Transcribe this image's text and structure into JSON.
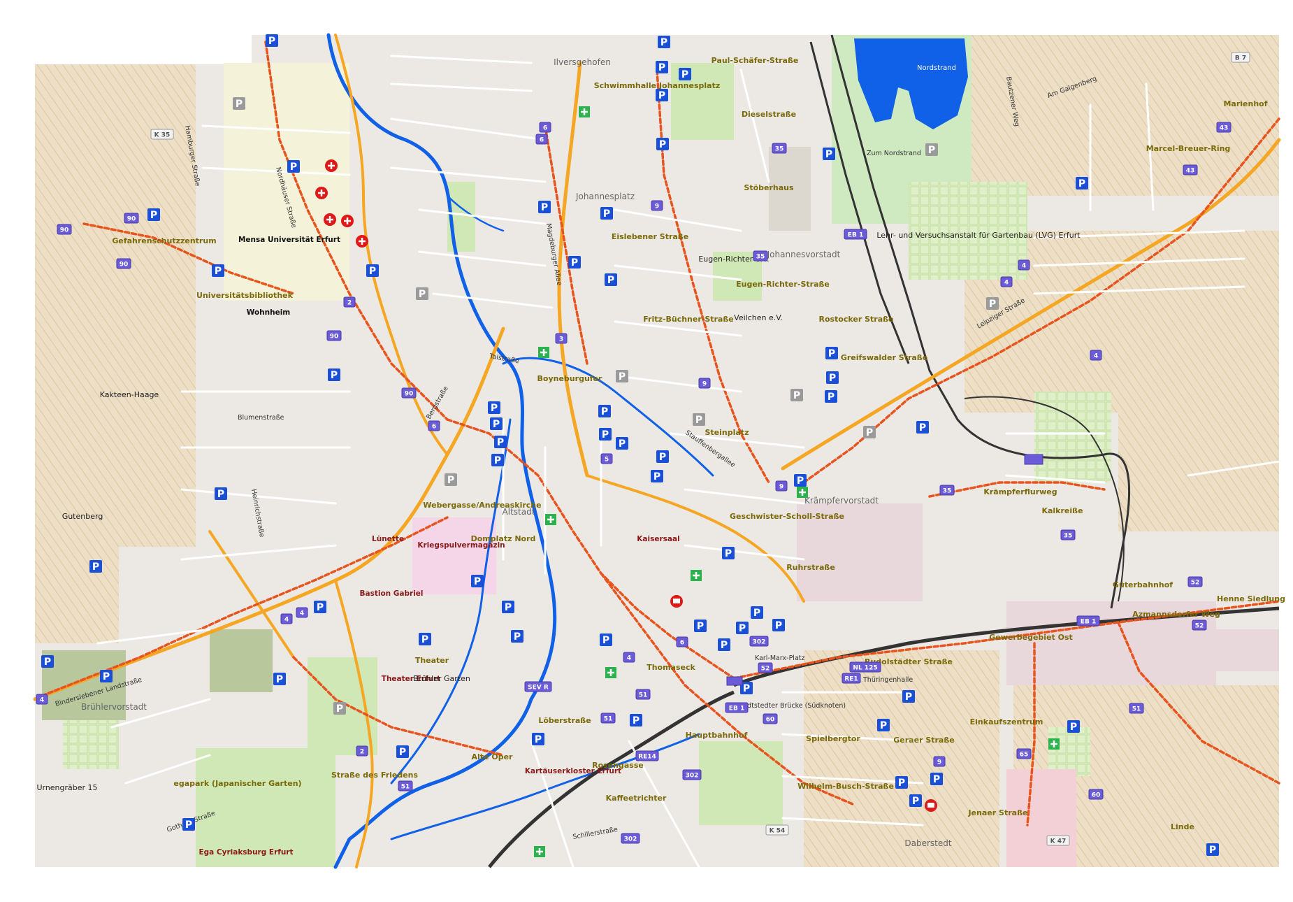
{
  "map": {
    "labels": {
      "districts": [
        "Ilversgehofen",
        "Johannesplatz",
        "Johannesvorstadt",
        "Krämpfervorstadt",
        "Altstadt",
        "Brühlervorstadt",
        "Daberstedt"
      ],
      "stops": [
        "Paul-Schäfer-Straße",
        "Schwimmhalle Johannesplatz",
        "Dieselstraße",
        "Marcel-Breuer-Ring",
        "Stöberhaus",
        "Eislebener Straße",
        "Eugen-Richter-Straße",
        "Rostocker Straße",
        "Fritz-Büchner-Straße",
        "Greifswalder Straße",
        "Boyneburgufer",
        "Steinplatz",
        "Universitätsbibliothek",
        "Gefahrenschutzzentrum",
        "Webergasse/Andreaskirche",
        "Krämpferflurweg",
        "Kalkreiße",
        "Geschwister-Scholl-Straße",
        "Ruhrstraße",
        "Domplatz Nord",
        "Theater",
        "Thomaseck",
        "Hauptbahnhof",
        "Rudolstädter Straße",
        "Gewerbegebiet Ost",
        "Azmannsdorfer Weg",
        "Henne Siedlung",
        "Güterbahnhof",
        "Einkaufszentrum",
        "Spielbergtor",
        "Geraer Straße",
        "Wilhelm-Busch-Straße",
        "Jenaer Straße",
        "Linde",
        "Löberstraße",
        "Alte Oper",
        "Straße des Friedens",
        "Rosengasse",
        "Kaffeetrichter",
        "Marienhof"
      ],
      "places": [
        "Mensa Universität Erfurt",
        "Wohnheim",
        "Kakteen-Haage",
        "Gutenberg",
        "Lünette",
        "Kriegspulvermagazin",
        "Bastion Gabriel",
        "Theater Erfurt",
        "Brühler Garten",
        "Kaisersaal",
        "Kartäuserkloster Erfurt",
        "egapark (Japanischer Garten)",
        "Ega Cyriaksburg Erfurt",
        "Urnengräber 15",
        "Nordstrand",
        "Lehr- und Versuchsanstalt für Gartenbau (LVG) Erfurt",
        "Eugen-Richter e.V.",
        "Veilchen e.V."
      ],
      "streets": [
        "Leipziger Straße",
        "Stauffenbergallee",
        "Talstraße",
        "Bergstraße",
        "Nordhäuser Straße",
        "Magdeburger Allee",
        "Binderslebener Landstraße",
        "Gothaer Straße",
        "Schillerstraße",
        "Blumenstraße",
        "Heinrichstraße",
        "Hamburger Straße",
        "Schmidtstedter Brücke (Südknoten)",
        "Zum Nordstrand",
        "Am Galgenberg",
        "Bautzener Weg",
        "Thüringenhalle",
        "Karl-Marx-Platz"
      ]
    },
    "road_shields": [
      "K 35",
      "B 7",
      "K 54",
      "K 47",
      "90",
      "2",
      "4",
      "3",
      "5",
      "6",
      "9",
      "35",
      "43",
      "51",
      "52",
      "60",
      "65",
      "302",
      "EB 1",
      "RE14",
      "NL 125",
      "RE1",
      "SEV R"
    ],
    "colors": {
      "water": "#1060e8",
      "primary_road": "#f5a623",
      "tram_route": "#e8541e",
      "rail": "#333333",
      "parking": "#1a4fd8",
      "stop_shield": "#6b5bd6",
      "farmland": "#eadfc8",
      "park": "#cfe8b5",
      "hospital": "#e01818"
    }
  }
}
